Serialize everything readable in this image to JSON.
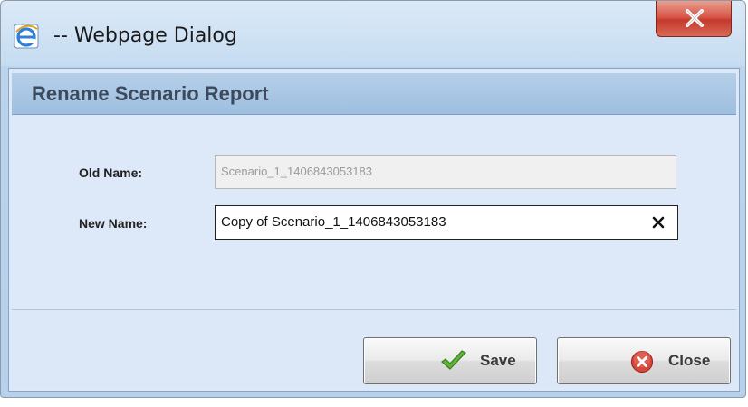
{
  "window": {
    "title": "-- Webpage Dialog",
    "browser_icon": "ie-icon",
    "close_icon": "close-icon"
  },
  "dialog": {
    "heading": "Rename Scenario Report"
  },
  "form": {
    "old_name_label": "Old Name:",
    "old_name_value": "Scenario_1_1406843053183",
    "new_name_label": "New Name:",
    "new_name_value": "Copy of Scenario_1_1406843053183",
    "clear_icon": "clear-x-icon"
  },
  "buttons": {
    "save_label": "Save",
    "save_icon": "checkmark-icon",
    "close_label": "Close",
    "close_icon": "red-x-circle-icon"
  },
  "colors": {
    "header_bar": "#a9c8e6",
    "close_button": "#d04a3c",
    "checkmark": "#4a9a2a"
  }
}
